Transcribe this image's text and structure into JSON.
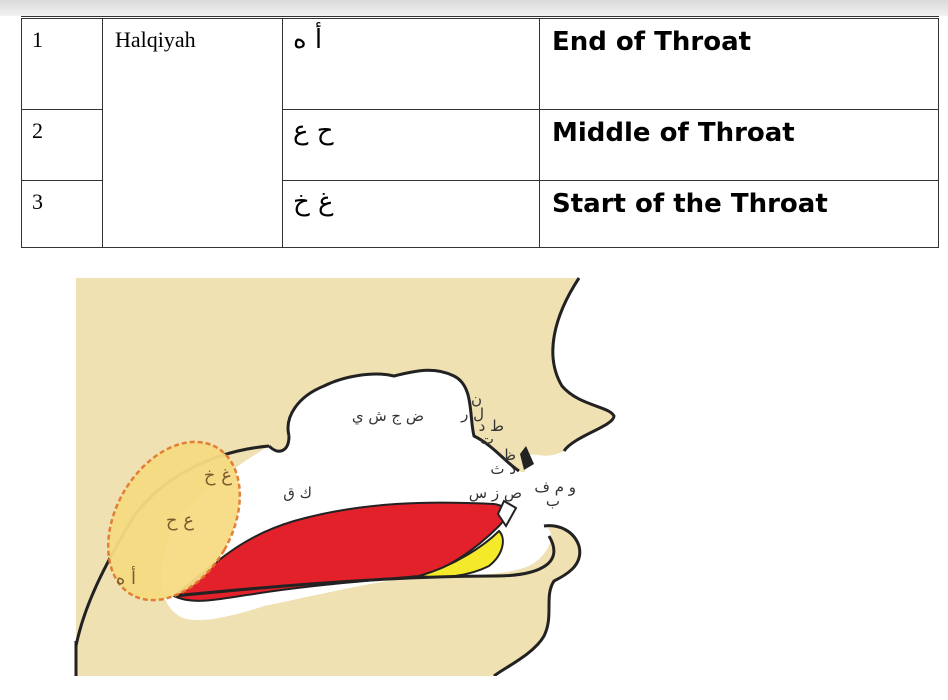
{
  "table": {
    "rows": [
      {
        "num": "1",
        "name": "Halqiyah",
        "letters": "أ ه",
        "description": "End of Throat"
      },
      {
        "num": "2",
        "name": "",
        "letters": "ح ع",
        "description": "Middle of Throat"
      },
      {
        "num": "3",
        "name": "",
        "letters": "غ خ",
        "description": "Start of the Throat"
      }
    ]
  },
  "diagram": {
    "labels": {
      "throat_start": "غ خ",
      "throat_middle": "ع ح",
      "throat_end": "أ ه",
      "back_tongue": "ك ق",
      "mid_tongue": "ض ج ش ي",
      "tip_1": "ن",
      "tip_2": "ل ر",
      "tip_3": "ط د",
      "tip_4": "ت",
      "tip_5": "ظ",
      "tip_6": "ذ ث",
      "tip_7": "ص ز س",
      "lips": "و م ف",
      "lips_2": "ب"
    },
    "colors": {
      "skin": "#efe1b2",
      "tongue": "#e2212a",
      "throat_zone": "#f7db83",
      "throat_border": "#e27a2e",
      "lower_lip": "#f5ea2a"
    }
  }
}
